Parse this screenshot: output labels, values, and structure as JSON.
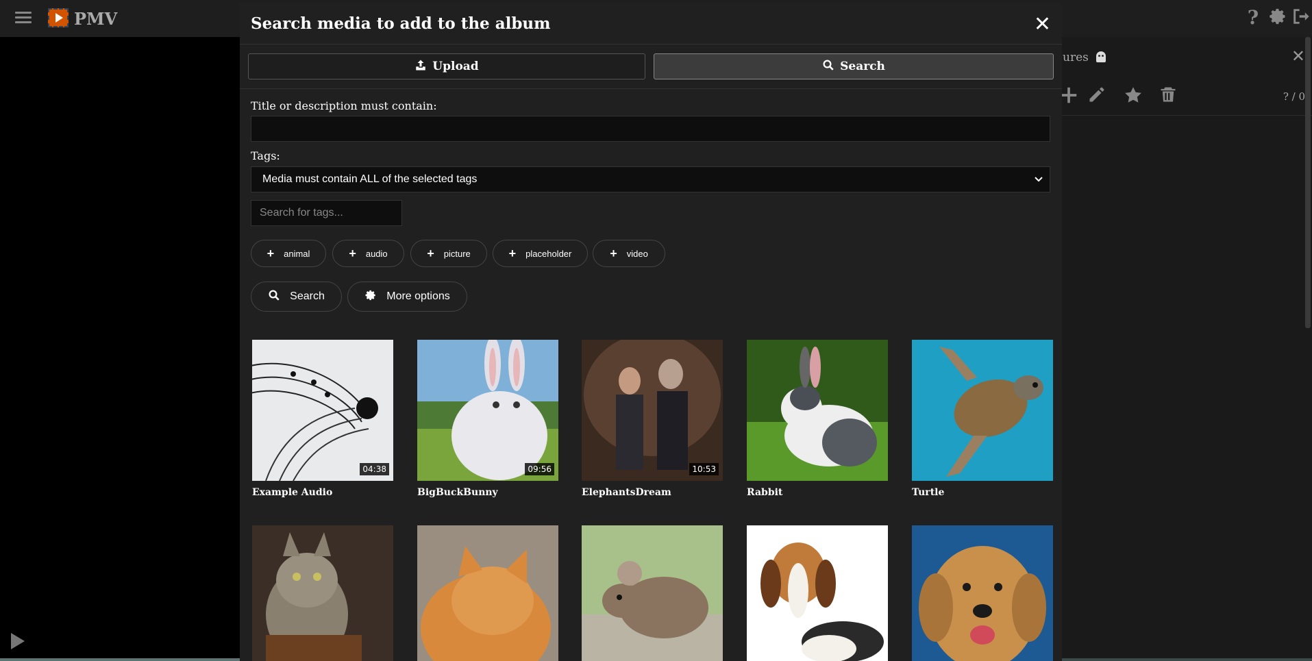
{
  "app": {
    "title": "PMV",
    "icons": [
      "menu-icon",
      "help-icon",
      "gear-icon",
      "logout-icon"
    ]
  },
  "side_panel": {
    "title_fragment": "ures",
    "count": "? / 0",
    "tools": [
      "plus-icon",
      "pencil-icon",
      "star-icon",
      "trash-icon"
    ]
  },
  "modal": {
    "title": "Search media to add to the album",
    "close": "✕",
    "tabs": [
      {
        "label": "Upload",
        "icon": "upload-icon",
        "active": false
      },
      {
        "label": "Search",
        "icon": "search-icon",
        "active": true
      }
    ],
    "title_label": "Title or description must contain:",
    "title_value": "",
    "tags_label": "Tags:",
    "tags_mode": "Media must contain ALL of the selected tags",
    "tag_search_placeholder": "Search for tags...",
    "tags": [
      "animal",
      "audio",
      "picture",
      "placeholder",
      "video"
    ],
    "search_button": "Search",
    "more_options_button": "More options"
  },
  "media": [
    {
      "title": "Example Audio",
      "duration": "04:38"
    },
    {
      "title": "BigBuckBunny",
      "duration": "09:56"
    },
    {
      "title": "ElephantsDream",
      "duration": "10:53"
    },
    {
      "title": "Rabbit",
      "duration": ""
    },
    {
      "title": "Turtle",
      "duration": ""
    },
    {
      "title": "",
      "duration": ""
    },
    {
      "title": "",
      "duration": ""
    },
    {
      "title": "",
      "duration": ""
    },
    {
      "title": "",
      "duration": ""
    },
    {
      "title": "",
      "duration": ""
    }
  ],
  "colors": {
    "background": "#000000",
    "topbar": "#1e1e1e",
    "modal": "#202020",
    "input": "#0e0e0e",
    "logo": "#d35400"
  }
}
